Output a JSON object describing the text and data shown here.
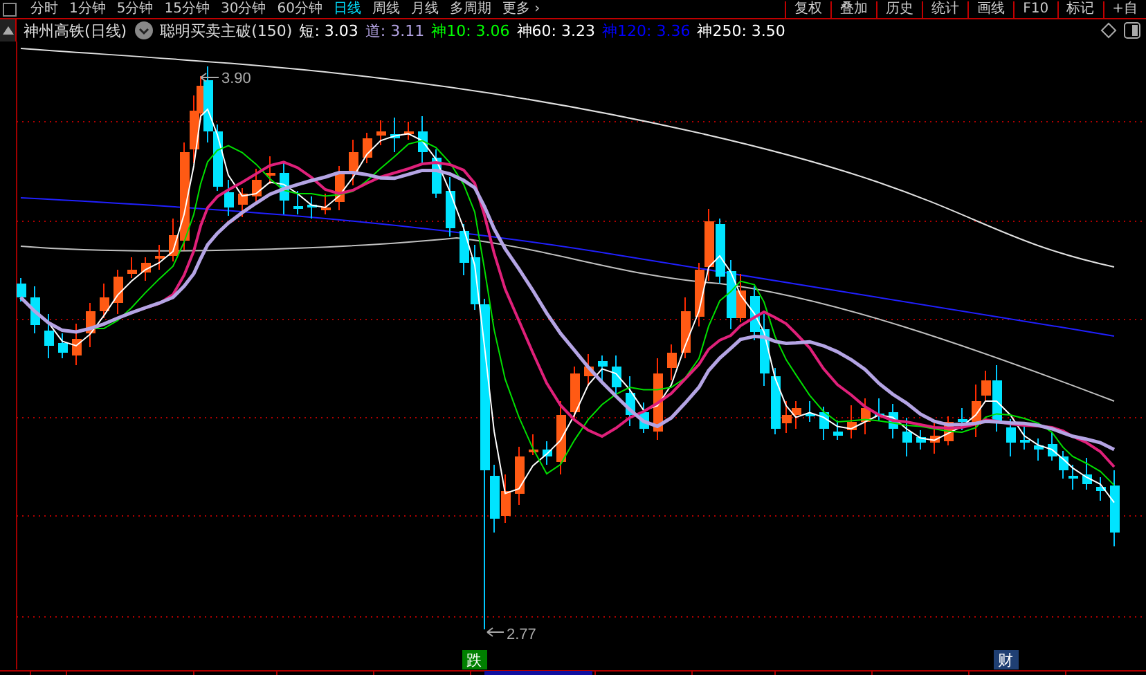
{
  "toolbar": {
    "periods": [
      {
        "label": "分时",
        "selected": false
      },
      {
        "label": "1分钟",
        "selected": false
      },
      {
        "label": "5分钟",
        "selected": false
      },
      {
        "label": "15分钟",
        "selected": false
      },
      {
        "label": "30分钟",
        "selected": false
      },
      {
        "label": "60分钟",
        "selected": false
      },
      {
        "label": "日线",
        "selected": true
      },
      {
        "label": "周线",
        "selected": false
      },
      {
        "label": "月线",
        "selected": false
      },
      {
        "label": "多周期",
        "selected": false
      },
      {
        "label": "更多 ›",
        "selected": false
      }
    ],
    "tools": [
      "复权",
      "叠加",
      "历史",
      "统计",
      "画线",
      "F10",
      "标记",
      "+自"
    ]
  },
  "legend": {
    "stock": "神州高铁(日线)",
    "indicator": "聪明买卖主破(150)",
    "values": [
      {
        "label": "短: 3.03",
        "color": "#ffffff"
      },
      {
        "label": "道: 3.11",
        "color": "#b4a4e4"
      },
      {
        "label": "神10: 3.06",
        "color": "#00ff00"
      },
      {
        "label": "神60: 3.23",
        "color": "#ffffff"
      },
      {
        "label": "神120: 3.36",
        "color": "#0000ff"
      },
      {
        "label": "神250: 3.50",
        "color": "#ffffff"
      }
    ]
  },
  "chart": {
    "high_label": "3.90",
    "low_label": "2.77",
    "markers": [
      {
        "label": "跌",
        "color": "#008000"
      },
      {
        "label": "财",
        "color": "#1f3f73"
      }
    ]
  }
}
